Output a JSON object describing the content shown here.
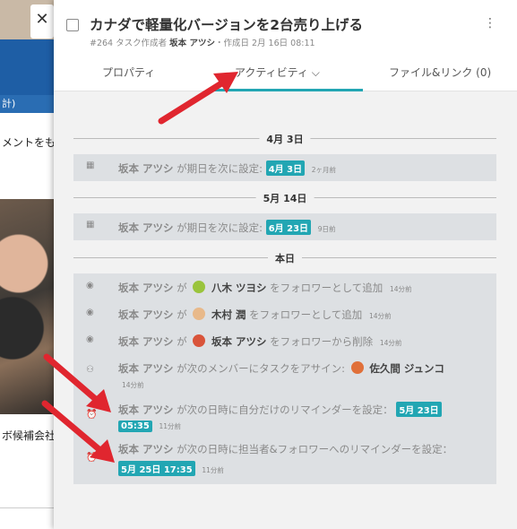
{
  "background": {
    "subbar_text": "計)",
    "text1": "メントをも",
    "text2": "ボ候補会社"
  },
  "close_label": "✕",
  "task": {
    "title": "カナダで軽量化バージョンを2台売り上げる",
    "meta_prefix": "#264 タスク作成者",
    "author": "坂本 アツシ",
    "meta_suffix": "・作成日 2月 16日 08:11",
    "kebab": "⋮"
  },
  "tabs": [
    {
      "label": "プロパティ"
    },
    {
      "label": "アクティビティ ⌵"
    },
    {
      "label": "ファイル&リンク (0)"
    }
  ],
  "dates": [
    "4月 3日",
    "5月 14日",
    "本日"
  ],
  "activities": [
    {
      "icon": "calendar-icon",
      "user": "坂本 アツシ",
      "text": "が期日を次に設定:",
      "tag": "4月 3日",
      "ago": "2ヶ月前"
    },
    {
      "icon": "calendar-icon",
      "user": "坂本 アツシ",
      "text": "が期日を次に設定:",
      "tag": "6月 23日",
      "ago": "9日前"
    },
    {
      "icon": "eye-icon",
      "user": "坂本 アツシ",
      "pre": "が",
      "target": "八木 ツヨシ",
      "text": "をフォロワーとして追加",
      "ago": "14分前",
      "avatar_color": "#9ac43c"
    },
    {
      "icon": "eye-icon",
      "user": "坂本 アツシ",
      "pre": "が",
      "target": "木村 潤",
      "text": "をフォロワーとして追加",
      "ago": "14分前",
      "avatar_color": "#e8b98a"
    },
    {
      "icon": "eye-icon",
      "user": "坂本 アツシ",
      "pre": "が",
      "target": "坂本 アツシ",
      "text": "をフォロワーから削除",
      "ago": "14分前",
      "avatar_color": "#d9543a"
    },
    {
      "icon": "user-add-icon",
      "user": "坂本 アツシ",
      "text": "が次のメンバーにタスクをアサイン:",
      "target": "佐久間 ジュンコ",
      "ago": "14分前",
      "avatar_color": "#e0703a"
    },
    {
      "icon": "alarm-icon",
      "user": "坂本 アツシ",
      "text": "が次の日時に自分だけのリマインダーを設定：",
      "tag": "5月 23日 05:35",
      "tag_part1": "5月 23日",
      "tag_part2": "05:35",
      "ago": "11分前"
    },
    {
      "icon": "alarm-icon",
      "user": "坂本 アツシ",
      "text": "が次の日時に担当者&フォロワーへのリマインダーを設定：",
      "tag": "5月 25日 17:35",
      "ago": "11分前"
    }
  ],
  "colors": {
    "accent": "#22a6b3",
    "arrow": "#e0262f"
  }
}
